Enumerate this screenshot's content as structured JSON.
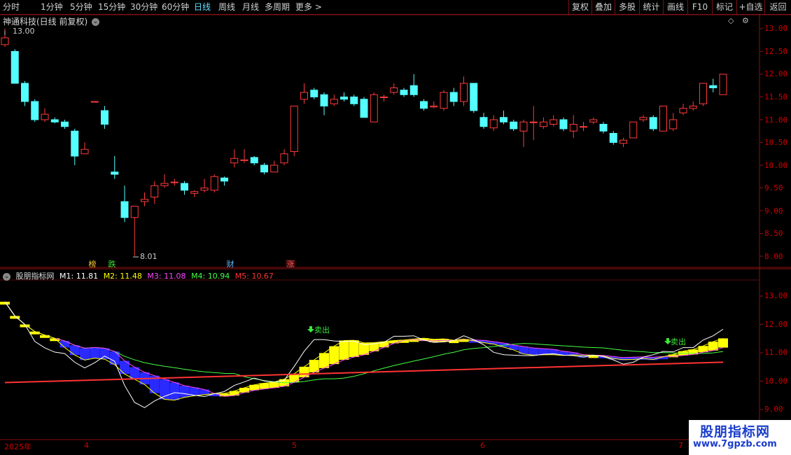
{
  "toolbar": {
    "periods": [
      "分时",
      "1分钟",
      "5分钟",
      "15分钟",
      "30分钟",
      "60分钟",
      "日线",
      "周线",
      "月线",
      "多周期",
      "更多 >"
    ],
    "active_period": "日线",
    "right_buttons": [
      "复权",
      "叠加",
      "多股",
      "统计",
      "画线",
      "F10",
      "标记",
      "+自选",
      "返回"
    ]
  },
  "stock": {
    "title": "神通科技(日线 前复权)",
    "high_label": "13.00",
    "low_label": "8.01"
  },
  "markers": [
    "榜",
    "跌",
    "财",
    "涨"
  ],
  "indicator": {
    "name": "股朋指标网",
    "m1": "M1: 11.81",
    "m2": "M2: 11.48",
    "m3": "M3: 11.08",
    "m4": "M4: 10.94",
    "m5": "M5: 10.67",
    "sell_label": "卖出",
    "colors": {
      "m1": "#ffffff",
      "m2": "#ffff00",
      "m3": "#ff44ff",
      "m4": "#44ff44",
      "m5": "#ff3333"
    }
  },
  "price_axis": [
    "13.00",
    "12.50",
    "12.00",
    "11.50",
    "11.00",
    "10.50",
    "10.00",
    "9.50",
    "9.00",
    "8.50",
    "8.00"
  ],
  "indicator_axis": [
    "13.00",
    "12.00",
    "11.00",
    "10.00",
    "9.00"
  ],
  "x_axis": [
    "2025年",
    "4",
    "5",
    "6",
    "7"
  ],
  "watermark": {
    "title": "股朋指标网",
    "url": "www.7gpzb.com"
  },
  "candles": [
    [
      12.65,
      12.8,
      12.6,
      13.0
    ],
    [
      12.5,
      11.8,
      11.8,
      12.55
    ],
    [
      11.8,
      11.4,
      11.3,
      11.85
    ],
    [
      11.4,
      11.0,
      10.95,
      11.45
    ],
    [
      11.0,
      11.12,
      10.95,
      11.25
    ],
    [
      11.0,
      10.95,
      10.92,
      11.05
    ],
    [
      10.95,
      10.85,
      10.8,
      11.0
    ],
    [
      10.75,
      10.2,
      10.0,
      10.8
    ],
    [
      10.25,
      10.35,
      10.25,
      10.5
    ],
    [
      11.4,
      11.4,
      11.4,
      11.4
    ],
    [
      11.2,
      10.9,
      10.8,
      11.3
    ],
    [
      9.85,
      9.8,
      9.7,
      10.2
    ],
    [
      9.2,
      8.85,
      8.75,
      9.55
    ],
    [
      8.85,
      9.1,
      8.01,
      9.1
    ],
    [
      9.2,
      9.25,
      9.1,
      9.4
    ],
    [
      9.3,
      9.55,
      9.15,
      9.65
    ],
    [
      9.55,
      9.6,
      9.5,
      9.8
    ],
    [
      9.63,
      9.63,
      9.55,
      9.7
    ],
    [
      9.6,
      9.45,
      9.35,
      9.65
    ],
    [
      9.38,
      9.42,
      9.3,
      9.45
    ],
    [
      9.45,
      9.5,
      9.4,
      9.7
    ],
    [
      9.45,
      9.75,
      9.4,
      9.8
    ],
    [
      9.72,
      9.65,
      9.55,
      9.75
    ],
    [
      10.05,
      10.15,
      9.95,
      10.35
    ],
    [
      10.1,
      10.12,
      10.05,
      10.35
    ],
    [
      10.17,
      10.05,
      10.0,
      10.2
    ],
    [
      10.0,
      9.85,
      9.8,
      10.05
    ],
    [
      9.85,
      10.0,
      9.85,
      10.1
    ],
    [
      10.05,
      10.25,
      10.0,
      10.35
    ],
    [
      10.3,
      11.3,
      10.2,
      11.3
    ],
    [
      11.45,
      11.6,
      11.35,
      11.8
    ],
    [
      11.65,
      11.5,
      11.45,
      11.7
    ],
    [
      11.55,
      11.3,
      11.1,
      11.6
    ],
    [
      11.35,
      11.45,
      11.3,
      11.55
    ],
    [
      11.5,
      11.45,
      11.4,
      11.6
    ],
    [
      11.5,
      11.35,
      11.3,
      11.55
    ],
    [
      11.45,
      11.05,
      11.05,
      11.5
    ],
    [
      10.95,
      11.55,
      10.95,
      11.6
    ],
    [
      11.5,
      11.5,
      11.4,
      11.55
    ],
    [
      11.6,
      11.7,
      11.55,
      11.8
    ],
    [
      11.65,
      11.55,
      11.5,
      11.7
    ],
    [
      11.75,
      11.55,
      11.5,
      12.0
    ],
    [
      11.4,
      11.25,
      11.2,
      11.45
    ],
    [
      11.28,
      11.3,
      11.25,
      11.4
    ],
    [
      11.25,
      11.6,
      11.2,
      11.65
    ],
    [
      11.6,
      11.4,
      11.3,
      11.7
    ],
    [
      11.4,
      11.8,
      11.3,
      11.95
    ],
    [
      11.8,
      11.2,
      11.15,
      11.8
    ],
    [
      11.05,
      10.85,
      10.8,
      11.15
    ],
    [
      10.82,
      11.0,
      10.75,
      11.1
    ],
    [
      11.05,
      10.95,
      10.9,
      11.2
    ],
    [
      10.95,
      10.8,
      10.75,
      11.0
    ],
    [
      10.75,
      10.95,
      10.4,
      11.0
    ],
    [
      10.95,
      10.95,
      10.55,
      11.3
    ],
    [
      10.85,
      10.95,
      10.8,
      11.05
    ],
    [
      10.9,
      11.0,
      10.85,
      11.1
    ],
    [
      11.0,
      10.8,
      10.75,
      11.05
    ],
    [
      10.75,
      10.9,
      10.6,
      11.1
    ],
    [
      10.85,
      10.85,
      10.75,
      10.95
    ],
    [
      10.95,
      11.0,
      10.9,
      11.05
    ],
    [
      10.9,
      10.75,
      10.7,
      10.95
    ],
    [
      10.7,
      10.5,
      10.45,
      10.75
    ],
    [
      10.48,
      10.55,
      10.4,
      10.6
    ],
    [
      10.6,
      10.95,
      10.6,
      10.95
    ],
    [
      11.0,
      11.05,
      10.95,
      11.1
    ],
    [
      11.05,
      10.8,
      10.75,
      11.1
    ],
    [
      10.75,
      11.3,
      10.75,
      11.3
    ],
    [
      10.8,
      11.0,
      10.75,
      11.15
    ],
    [
      11.15,
      11.25,
      11.1,
      11.35
    ],
    [
      11.25,
      11.3,
      11.2,
      11.4
    ],
    [
      11.35,
      11.8,
      11.3,
      11.8
    ],
    [
      11.75,
      11.7,
      11.6,
      11.9
    ],
    [
      11.55,
      12.0,
      11.55,
      12.0
    ]
  ]
}
